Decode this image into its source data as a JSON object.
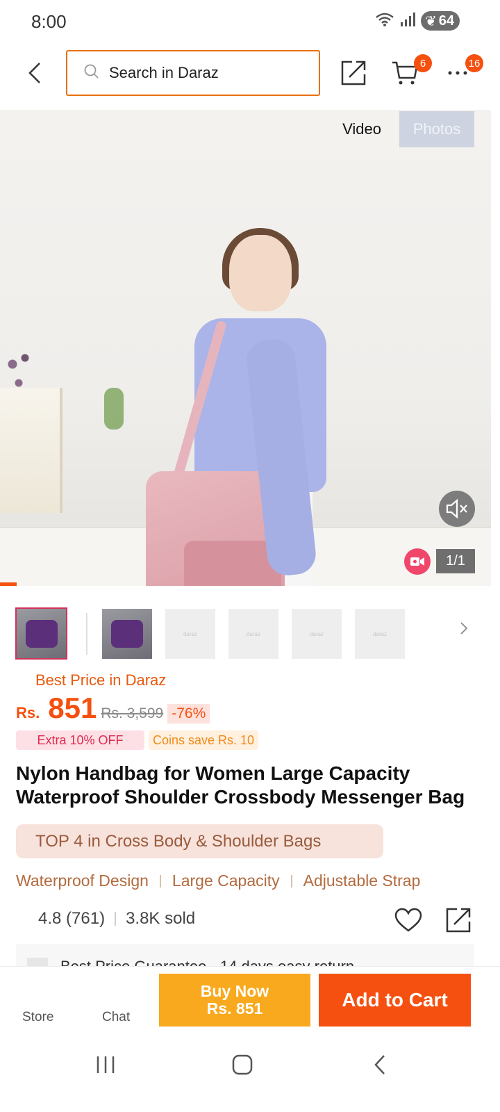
{
  "status_bar": {
    "time": "8:00",
    "battery": "64"
  },
  "header": {
    "search_placeholder": "Search in Daraz",
    "cart_badge": "6",
    "more_badge": "16"
  },
  "gallery": {
    "tab_video": "Video",
    "tab_photos": "Photos",
    "counter": "1/1",
    "thumbnail_placeholder": "daraz"
  },
  "product": {
    "best_price_label": "Best Price in Daraz",
    "currency": "Rs.",
    "price": "851",
    "original_price": "Rs. 3,599",
    "discount": "-76%",
    "promo_extra": "Extra 10% OFF",
    "promo_coins": "Coins save Rs. 10",
    "title": "Nylon Handbag for Women Large Capacity Waterproof Shoulder Crossbody Messenger Bag",
    "rank": "TOP 4 in Cross Body & Shoulder Bags",
    "features": [
      "Waterproof Design",
      "Large Capacity",
      "Adjustable Strap"
    ],
    "rating": "4.8 (761)",
    "sold": "3.8K sold",
    "guarantee_text": "Best Price Guarantee · 14 days easy return"
  },
  "action_bar": {
    "store": "Store",
    "chat": "Chat",
    "buy_now_line1": "Buy Now",
    "buy_now_line2": "Rs. 851",
    "add_to_cart": "Add to Cart"
  },
  "colors": {
    "accent": "#f5500f",
    "buy_now": "#f8a91e",
    "search_border": "#e8700f"
  }
}
